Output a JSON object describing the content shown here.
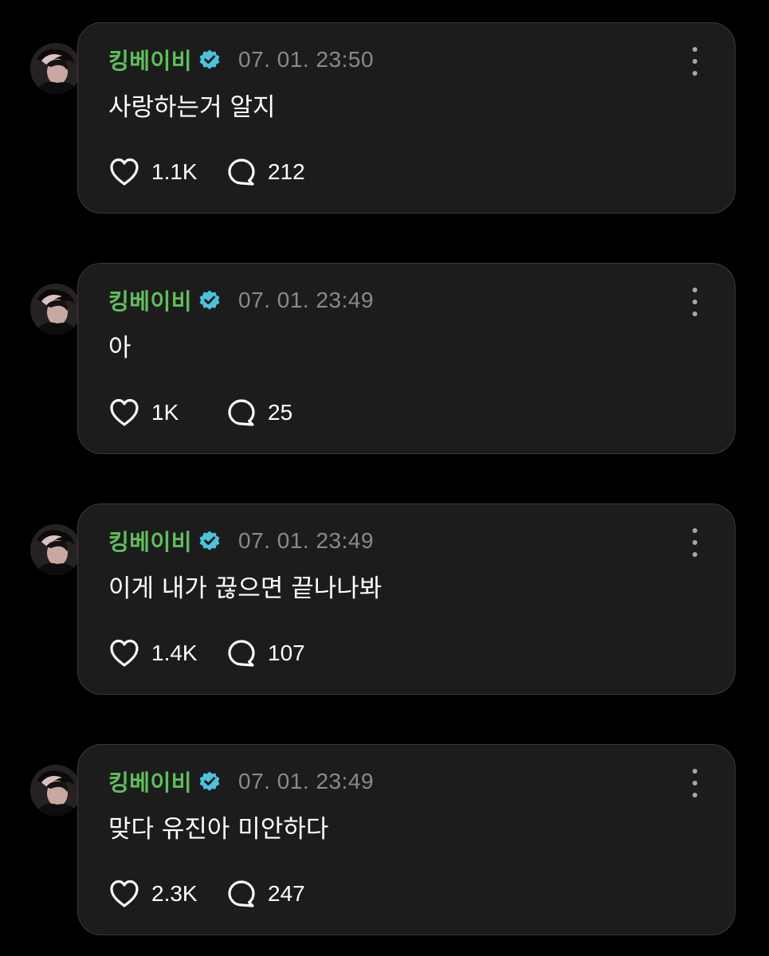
{
  "colors": {
    "background": "#000000",
    "card": "#1c1c1c",
    "card_border": "#3a3a3a",
    "username": "#5fbf5a",
    "verified_badge": "#4cc3dd",
    "timestamp": "#8a8a8a",
    "text": "#ffffff"
  },
  "icons": {
    "verified": "verified-badge-icon",
    "more": "more-vertical-icon",
    "like": "heart-icon",
    "comment": "speech-bubble-icon"
  },
  "posts": [
    {
      "username": "킹베이비",
      "timestamp": "07. 01. 23:50",
      "text": "사랑하는거 알지",
      "likes": "1.1K",
      "comments": "212"
    },
    {
      "username": "킹베이비",
      "timestamp": "07. 01. 23:49",
      "text": "아",
      "likes": "1K",
      "comments": "25"
    },
    {
      "username": "킹베이비",
      "timestamp": "07. 01. 23:49",
      "text": "이게 내가 끊으면 끝나나봐",
      "likes": "1.4K",
      "comments": "107"
    },
    {
      "username": "킹베이비",
      "timestamp": "07. 01. 23:49",
      "text": "맞다 유진아 미안하다",
      "likes": "2.3K",
      "comments": "247"
    }
  ]
}
